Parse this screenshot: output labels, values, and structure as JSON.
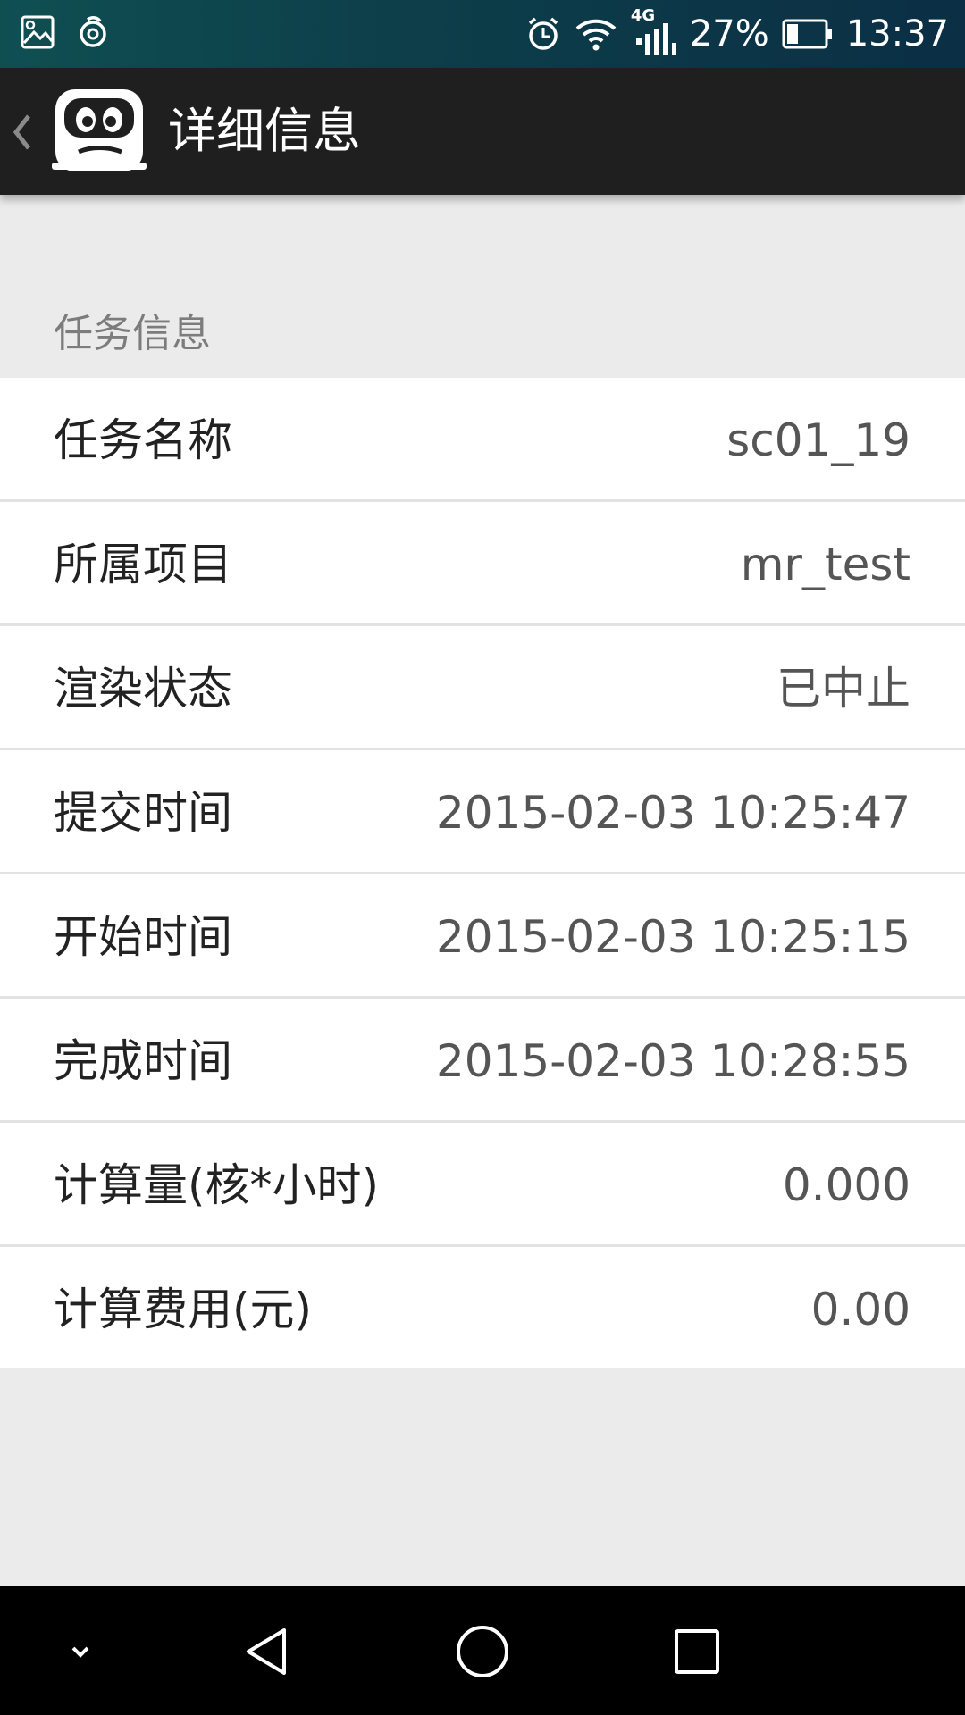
{
  "status_bar": {
    "battery_percent": "27%",
    "time": "13:37",
    "network_label": "4G",
    "icons": [
      "gallery-icon",
      "sync-icon",
      "alarm-icon",
      "wifi-icon",
      "signal-icon",
      "battery-icon"
    ]
  },
  "action_bar": {
    "title": "详细信息",
    "icons": [
      "back-chevron-icon",
      "app-logo-icon"
    ]
  },
  "section": {
    "title": "任务信息"
  },
  "rows": [
    {
      "label": "任务名称",
      "value": "sc01_19"
    },
    {
      "label": "所属项目",
      "value": "mr_test"
    },
    {
      "label": "渲染状态",
      "value": "已中止"
    },
    {
      "label": "提交时间",
      "value": "2015-02-03 10:25:47"
    },
    {
      "label": "开始时间",
      "value": "2015-02-03 10:25:15"
    },
    {
      "label": "完成时间",
      "value": "2015-02-03 10:28:55"
    },
    {
      "label": "计算量(核*小时)",
      "value": "0.000"
    },
    {
      "label": "计算费用(元)",
      "value": "0.00"
    }
  ],
  "nav_bar": {
    "icons": [
      "collapse-icon",
      "back-icon",
      "home-icon",
      "recents-icon"
    ]
  },
  "colors": {
    "status_bar_bg": "#0d3f4a",
    "action_bar_bg": "#1f1f1f",
    "page_bg": "#ebebeb",
    "row_bg": "#ffffff",
    "divider": "#e2e2e2"
  }
}
